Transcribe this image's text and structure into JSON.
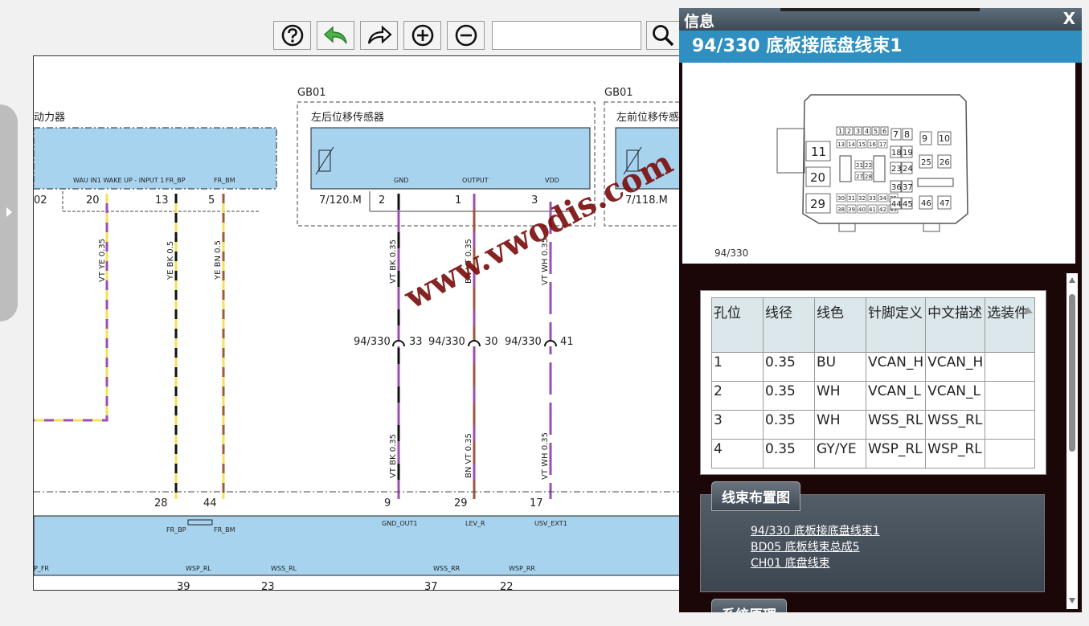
{
  "toolbar": {
    "help_icon": "question-circle-icon",
    "undo_icon": "back-arrow-icon",
    "redo_icon": "forward-arrow-icon",
    "zoom_in_icon": "plus-circle-icon",
    "zoom_out_icon": "minus-circle-icon",
    "search_icon": "magnifier-icon",
    "search_value": ""
  },
  "diagram": {
    "group1": {
      "code": "GB01",
      "name": "左后位移传感器",
      "ref": "7/120.M",
      "pins": [
        {
          "no": "2",
          "name": "GND"
        },
        {
          "no": "1",
          "name": "OUTPUT"
        },
        {
          "no": "3",
          "name": "VDD"
        }
      ]
    },
    "group2": {
      "code": "GB01",
      "name": "左前位移传感器",
      "ref": "7/118.M"
    },
    "left_module": {
      "name": "动力器",
      "pin_label": "WAU IN1 WAKE UP - INPUT 1",
      "pins": [
        {
          "no": "02",
          "name": ""
        },
        {
          "no": "20",
          "name": "WAU IN1 WAKE UP - INPUT 1"
        },
        {
          "no": "13",
          "name": "FR_BP"
        },
        {
          "no": "5",
          "name": "FR_BM"
        }
      ]
    },
    "wires_top": [
      "VT YE 0.35",
      "YE BK 0.5",
      "YE BN 0.5",
      "VT BK 0.35",
      "BN VT 0.35",
      "VT WH 0.35"
    ],
    "wires_bottom": [
      "VT BK 0.35",
      "BN VT 0.35",
      "VT WH 0.35"
    ],
    "splices": [
      {
        "conn": "94/330",
        "pin": "33"
      },
      {
        "conn": "94/330",
        "pin": "30"
      },
      {
        "conn": "94/330",
        "pin": "41"
      }
    ],
    "bottom_module": {
      "pins": [
        {
          "no": "28",
          "name": "FR_BP"
        },
        {
          "no": "44",
          "name": "FR_BM"
        },
        {
          "no": "9",
          "name": "GND_OUT1"
        },
        {
          "no": "29",
          "name": "LEV_R"
        },
        {
          "no": "17",
          "name": "USV_EXT1"
        }
      ],
      "bottom_labels": [
        "P_FR",
        "WSP_RL",
        "WSS_RL",
        "WSS_RR",
        "WSP_RR"
      ],
      "bottom_pins": [
        "39",
        "23",
        "37",
        "22"
      ]
    },
    "watermark": "www.vwodis.com",
    "colors": {
      "module_fill": "#a7d3ef",
      "violet": "#9b4fb0",
      "yellow": "#f1e15b",
      "brown": "#9a5a3c",
      "watermark": "#7a0c0c"
    }
  },
  "panel": {
    "title": "信息",
    "close": "X",
    "subtitle": "94/330 底板接底盘线束1",
    "connector_label": "94/330",
    "connector": {
      "small_pins_row1": [
        "1",
        "2",
        "3",
        "4",
        "5",
        "6"
      ],
      "pins_7_8": [
        "7",
        "8"
      ],
      "pins_9_10": [
        "9",
        "10"
      ],
      "row2": [
        "13",
        "14",
        "15",
        "16",
        "17"
      ],
      "big_pins": [
        "11",
        "20",
        "29"
      ],
      "pins_18_19": [
        "18",
        "19"
      ],
      "pins_21_22": [
        "21",
        "22"
      ],
      "pins_23_24": [
        "23",
        "24"
      ],
      "pins_25_26": [
        "25",
        "26"
      ],
      "pins_27_28": [
        "27",
        "28"
      ],
      "pins_36_37": [
        "36",
        "37"
      ],
      "row_30": [
        "30",
        "31",
        "32",
        "33",
        "34",
        "35"
      ],
      "row_38": [
        "38",
        "39",
        "40",
        "41",
        "42",
        "43"
      ],
      "pins_44_45": [
        "44",
        "45"
      ],
      "pins_46_47": [
        "46",
        "47"
      ]
    },
    "table": {
      "headers": [
        "孔位",
        "线径",
        "线色",
        "针脚定义",
        "中文描述",
        "选装件"
      ],
      "rows": [
        [
          "1",
          "0.35",
          "BU",
          "VCAN_H",
          "VCAN_H",
          ""
        ],
        [
          "2",
          "0.35",
          "WH",
          "VCAN_L",
          "VCAN_L",
          ""
        ],
        [
          "3",
          "0.35",
          "WH",
          "WSS_RL",
          "WSS_RL",
          ""
        ],
        [
          "4",
          "0.35",
          "GY/YE",
          "WSP_RL",
          "WSP_RL",
          ""
        ]
      ]
    },
    "harness_section": {
      "title": "线束布置图",
      "links": [
        "94/330 底板接底盘线束1",
        "BD05 底板线束总成5",
        "CH01 底盘线束"
      ]
    },
    "next_section": {
      "title": "系统原理"
    }
  }
}
